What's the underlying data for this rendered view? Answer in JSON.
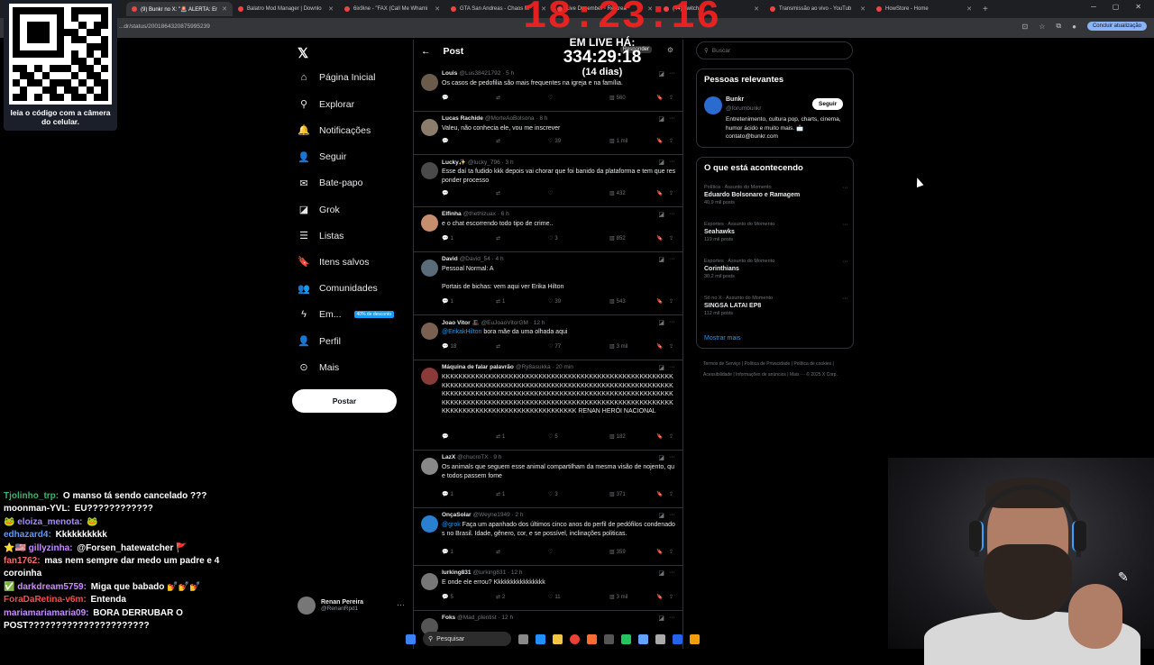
{
  "browser": {
    "tabs": [
      {
        "label": "(9) Bunkr no X: \"🚨 ALERTA: Er"
      },
      {
        "label": "Balatro Mod Manager | Downlo"
      },
      {
        "label": "6ix9ine - \"FAX (Call Me Whami"
      },
      {
        "label": "GTA San Andreas - Chaos M"
      },
      {
        "label": "Live December - Restrea"
      },
      {
        "label": "(44) Twitch"
      },
      {
        "label": "Transmissão ao vivo - YouTub"
      },
      {
        "label": "HowStore - Home"
      }
    ],
    "url": "...dr/status/2001864320875995239",
    "update_button": "Concluir atualização"
  },
  "overlay": {
    "qr_caption": "leia o código com a câmera do celular.",
    "clock": "18:23:16",
    "live_label": "EM LIVE HÁ:",
    "live_time": "334:29:18",
    "live_days": "(14 dias)"
  },
  "sidebar": {
    "nav": [
      {
        "label": "Página Inicial",
        "icon": "home-icon",
        "glyph": "⌂"
      },
      {
        "label": "Explorar",
        "icon": "search-icon",
        "glyph": "⚲"
      },
      {
        "label": "Notificações",
        "icon": "bell-icon",
        "glyph": "🔔"
      },
      {
        "label": "Seguir",
        "icon": "person-add-icon",
        "glyph": "👤"
      },
      {
        "label": "Bate-papo",
        "icon": "mail-icon",
        "glyph": "✉"
      },
      {
        "label": "Grok",
        "icon": "grok-icon",
        "glyph": "◪"
      },
      {
        "label": "Listas",
        "icon": "list-icon",
        "glyph": "☰"
      },
      {
        "label": "Itens salvos",
        "icon": "bookmark-icon",
        "glyph": "🔖"
      },
      {
        "label": "Comunidades",
        "icon": "communities-icon",
        "glyph": "👥"
      },
      {
        "label": "Em...",
        "icon": "lightning-icon",
        "glyph": "ϟ"
      },
      {
        "label": "Perfil",
        "icon": "profile-icon",
        "glyph": "👤"
      },
      {
        "label": "Mais",
        "icon": "more-circle-icon",
        "glyph": "⊙"
      }
    ],
    "promo_badge": "40% de desconto",
    "post_button": "Postar",
    "account_name": "Renan Pereira",
    "account_handle": "@RenanRpd1"
  },
  "feed": {
    "title": "Post",
    "reply_label": "Responder",
    "tweets": [
      {
        "name": "Louis",
        "handle": "@Lus38421792",
        "time": "5 h",
        "text": "Os casos de pedofilia são mais frequentes na igreja e na família.",
        "replies": "",
        "retweets": "",
        "likes": "",
        "views": "560"
      },
      {
        "name": "Lucas Rachide",
        "handle": "@MorteAoBolsona",
        "time": "8 h",
        "text": "Valeu, não conhecia ele, vou me inscrever",
        "replies": "",
        "retweets": "",
        "likes": "39",
        "views": "1 mil"
      },
      {
        "name": "Lucky✨",
        "handle": "@lucky_796",
        "time": "3 h",
        "text": "Esse daí ta fudido kkk depois vai chorar que foi banido da plataforma e tem que responder processo",
        "replies": "",
        "retweets": "",
        "likes": "",
        "views": "432"
      },
      {
        "name": "Elfinha",
        "handle": "@thethizuax",
        "time": "6 h",
        "text": "e o chat escorrendo todo tipo de crime..",
        "replies": "1",
        "retweets": "",
        "likes": "3",
        "views": "852"
      },
      {
        "name": "David",
        "handle": "@David_54",
        "time": "4 h",
        "text": "Pessoal Normal: A",
        "text2": "Portais de bichas: vem aqui ver Erika Hilton",
        "replies": "1",
        "retweets": "1",
        "likes": "39",
        "views": "543"
      },
      {
        "name": "Joao Vitor 🎩",
        "handle": "@EuJoaoVitorGM",
        "time": "12 h",
        "mention": "@ErikakHilton",
        "text": " bora mãe da uma olhada aqui",
        "replies": "18",
        "retweets": "",
        "likes": "77",
        "views": "3 mil"
      },
      {
        "name": "Máquina de falar palavrão",
        "handle": "@Ry8asukka",
        "time": "20 min",
        "text": "KKKKKKKKKKKKKKKKKKKKKKKKKKKKKKKKKKKKKKKKKKKKKKKKKKKKKKKKKKKKKKKKKKKKKKKKKKKKKKKKKKKKKKKKKKKKKKKKKKKKKKKKKKKKKKKKKKKKKKKKKKKKKKKKKKKKKKKKKKKKKKKKKKKKKKKKKKKKKKKKKKKKKKKKKKKKKKKKKKKKKKKKKKKKKKKKKKKKKKKKKKKKKKKKKKKKKKKKKKKKKKKKKKKKKKKKKKKKKKKKKKKKKKKKKKKK RENAN HERÓI NACIONAL",
        "replies": "",
        "retweets": "1",
        "likes": "5",
        "views": "182"
      },
      {
        "name": "LazX",
        "handle": "@chucroTX",
        "time": "9 h",
        "text": "Os animals que seguem esse animal compartilham da mesma visão de nojento, que todos passem fome",
        "replies": "1",
        "retweets": "1",
        "likes": "3",
        "views": "371"
      },
      {
        "name": "OnçaSolar",
        "handle": "@Weyne1949",
        "time": "2 h",
        "mention": "@grok",
        "text": " Faça um apanhado dos últimos cinco anos do perfil de pedófilos condenados no Brasil. Idade, gênero, cor, e se possível, inclinações politicas.",
        "replies": "1",
        "retweets": "",
        "likes": "",
        "views": "359"
      },
      {
        "name": "lurking831",
        "handle": "@lurking831",
        "time": "12 h",
        "text": "E onde ele errou? Kkkkkkkkkkkkkkkk",
        "replies": "5",
        "retweets": "2",
        "likes": "11",
        "views": "3 mil"
      },
      {
        "name": "Foks",
        "handle": "@Mad_plentist",
        "time": "12 h",
        "text": "",
        "replies": "",
        "retweets": "",
        "likes": "",
        "views": ""
      }
    ]
  },
  "right": {
    "search_placeholder": "Buscar",
    "relevant_title": "Pessoas relevantes",
    "rel_name": "Bunkr",
    "rel_handle": "@forumbunkr",
    "follow_label": "Seguir",
    "rel_bio": "Entretenimento, cultura pop, charts, cinema, humor ácido e muito mais. 📩 contato@bunkr.com",
    "trending_title": "O que está acontecendo",
    "trends": [
      {
        "category": "Política · Assunto do Momento",
        "name": "Eduardo Bolsonaro e Ramagem",
        "count": "40,9 mil posts"
      },
      {
        "category": "Esportes · Assunto do Momento",
        "name": "Seahawks",
        "count": "119 mil posts"
      },
      {
        "category": "Esportes · Assunto do Momento",
        "name": "Corinthians",
        "count": "30,2 mil posts"
      },
      {
        "category": "Só no X · Assunto do Momento",
        "name": "SINGSA LATAI EP8",
        "count": "112 mil posts"
      }
    ],
    "show_more": "Mostrar mais",
    "footer": "Termos de Serviço | Política de Privacidade | Política de cookies | Acessibilidade | Informações de anúncios | Mais ··· © 2025 X Corp."
  },
  "chat": [
    {
      "user": "Tjolinho_trp:",
      "msg": " O manso tá sendo cancelado ???",
      "color": "#3cb371"
    },
    {
      "user": "moonman-YVL:",
      "msg": " EU????????????",
      "color": "#ffffff"
    },
    {
      "user": "🐸 eloiza_menota:",
      "msg": " 🐸",
      "color": "#a78bfa"
    },
    {
      "user": "edhazard4:",
      "msg": " Kkkkkkkkkk",
      "color": "#5b9bff"
    },
    {
      "user": "⭐🇺🇸 gillyzinha:",
      "msg": " @Forsen_hatewatcher 🚩",
      "color": "#c98cff"
    },
    {
      "user": "fan1762:",
      "msg": " mas nem sempre dar medo um padre e 4 coroinha",
      "color": "#ff6b6b"
    },
    {
      "user": "✅ darkdream5759:",
      "msg": " Miga que babado 💅💅💅",
      "color": "#c98cff"
    },
    {
      "user": "ForaDaRetina-v6m:",
      "msg": " Entenda",
      "color": "#ff4a4a"
    },
    {
      "user": "mariamariamaria09:",
      "msg": " BORA DERRUBAR O POST??????????????????????",
      "color": "#c98cff"
    }
  ],
  "taskbar": {
    "search_label": "Pesquisar"
  }
}
